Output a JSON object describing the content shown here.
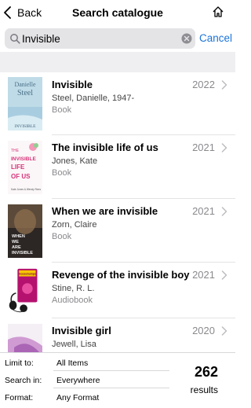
{
  "nav": {
    "back_label": "Back",
    "title": "Search catalogue"
  },
  "search": {
    "query": "Invisible",
    "cancel_label": "Cancel"
  },
  "results": [
    {
      "title": "Invisible",
      "author": "Steel, Danielle, 1947-",
      "format": "Book",
      "year": "2022",
      "cover_text": [
        "Danielle",
        "Steel",
        "INVISIBLE"
      ]
    },
    {
      "title": "The invisible life of us",
      "author": "Jones, Kate",
      "format": "Book",
      "year": "2021",
      "cover_text": [
        "THE",
        "INVISIBLE",
        "LIFE",
        "OF US",
        "Kate Jones & Wendy Rees"
      ]
    },
    {
      "title": "When we are invisible",
      "author": "Zorn, Claire",
      "format": "Book",
      "year": "2021",
      "cover_text": [
        "WHEN",
        "WE",
        "ARE",
        "INVISIBLE"
      ]
    },
    {
      "title": "Revenge of the invisible boy",
      "author": "Stine, R. L.",
      "format": "Audiobook",
      "year": "2021",
      "cover_text": [
        "Goosebumps"
      ]
    },
    {
      "title": "Invisible girl",
      "author": "Jewell, Lisa",
      "format": "",
      "year": "2020",
      "cover_text": []
    }
  ],
  "filters": {
    "limit_label": "Limit to:",
    "limit_value": "All Items",
    "search_in_label": "Search in:",
    "search_in_value": "Everywhere",
    "format_label": "Format:",
    "format_value": "Any Format"
  },
  "summary": {
    "count": "262",
    "count_label": "results"
  },
  "colors": {
    "accent": "#1a73d9",
    "band": "#efeff2",
    "field": "#e4e4e7"
  }
}
